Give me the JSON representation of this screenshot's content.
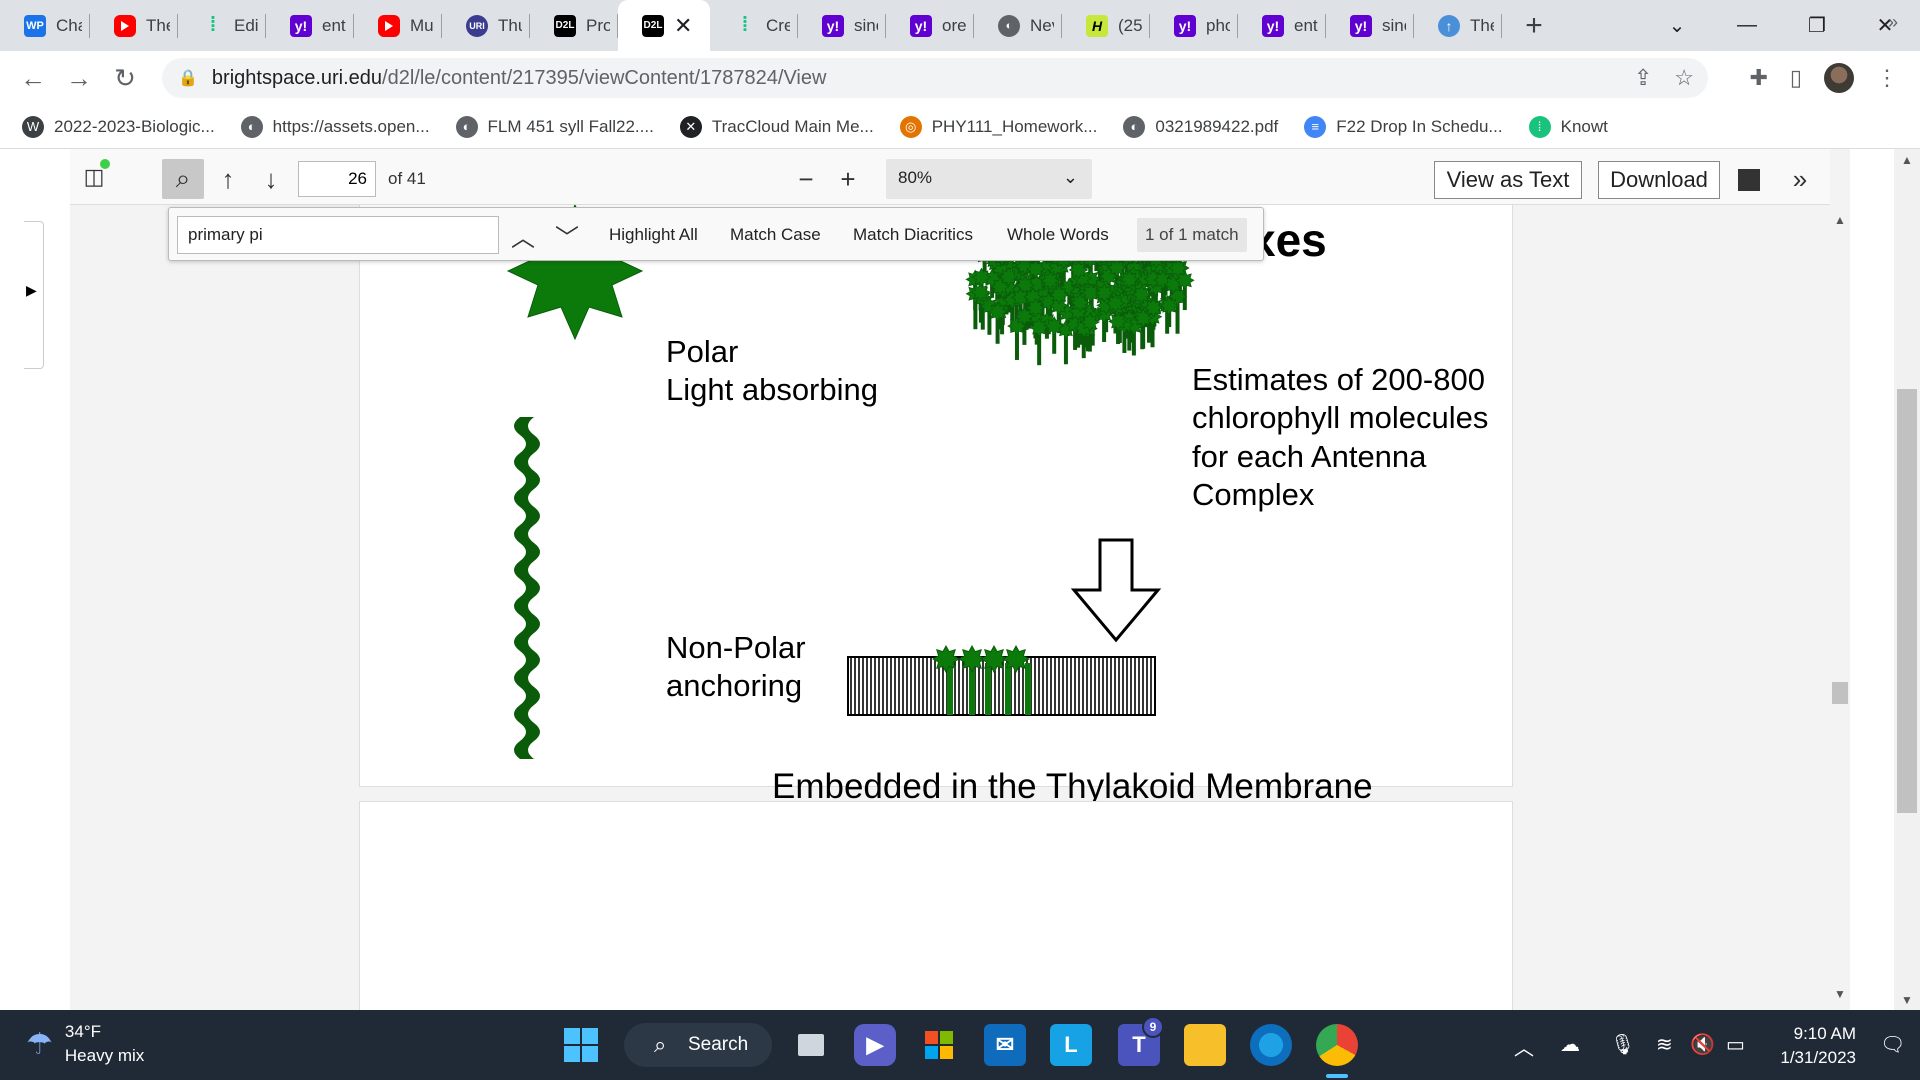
{
  "tabs": [
    {
      "label": "Cha",
      "icon": "wordpress-icon",
      "fav": "fav-wp",
      "glyph": "WP"
    },
    {
      "label": "The",
      "icon": "youtube-icon",
      "fav": "fav-yt",
      "glyph": ""
    },
    {
      "label": "Edit",
      "icon": "dots-icon",
      "fav": "fav-green",
      "glyph": "⁞"
    },
    {
      "label": "ent",
      "icon": "yahoo-icon",
      "fav": "fav-yahoo",
      "glyph": "y!"
    },
    {
      "label": "Mu",
      "icon": "youtube-icon",
      "fav": "fav-yt",
      "glyph": ""
    },
    {
      "label": "Thu",
      "icon": "uri-icon",
      "fav": "fav-uri",
      "glyph": "URI"
    },
    {
      "label": "Pro",
      "icon": "d2l-icon",
      "fav": "fav-d2l",
      "glyph": "D2L"
    },
    {
      "label": "",
      "icon": "d2l-icon",
      "fav": "fav-d2l",
      "glyph": "D2L",
      "active": true
    },
    {
      "label": "Cre",
      "icon": "dots-icon",
      "fav": "fav-green",
      "glyph": "⁞"
    },
    {
      "label": "sinc",
      "icon": "yahoo-icon",
      "fav": "fav-yahoo",
      "glyph": "y!"
    },
    {
      "label": "ore",
      "icon": "yahoo-icon",
      "fav": "fav-yahoo",
      "glyph": "y!"
    },
    {
      "label": "Nev",
      "icon": "globe-icon",
      "fav": "fav-globe",
      "glyph": "◐"
    },
    {
      "label": "(25)",
      "icon": "h-icon",
      "fav": "fav-h",
      "glyph": "H"
    },
    {
      "label": "pho",
      "icon": "yahoo-icon",
      "fav": "fav-yahoo",
      "glyph": "y!"
    },
    {
      "label": "ent",
      "icon": "yahoo-icon",
      "fav": "fav-yahoo",
      "glyph": "y!"
    },
    {
      "label": "sinc",
      "icon": "yahoo-icon",
      "fav": "fav-yahoo",
      "glyph": "y!"
    },
    {
      "label": "The",
      "icon": "upload-icon",
      "fav": "fav-up",
      "glyph": "↑"
    }
  ],
  "address": {
    "host": "brightspace.uri.edu",
    "path": "/d2l/le/content/217395/viewContent/1787824/View"
  },
  "bookmarks": [
    {
      "label": "2022-2023-Biologic...",
      "icon": "wordpress-icon",
      "color": "#3c4043",
      "glyph": "W"
    },
    {
      "label": "https://assets.open...",
      "icon": "globe-icon",
      "color": "#5f6368",
      "glyph": "◐"
    },
    {
      "label": "FLM 451 syll Fall22....",
      "icon": "globe-icon",
      "color": "#5f6368",
      "glyph": "◐"
    },
    {
      "label": "TracCloud Main Me...",
      "icon": "traccloud-icon",
      "color": "#202124",
      "glyph": "✕"
    },
    {
      "label": "PHY111_Homework...",
      "icon": "ring-icon",
      "color": "#e37400",
      "glyph": "◎"
    },
    {
      "label": "0321989422.pdf",
      "icon": "globe-icon",
      "color": "#5f6368",
      "glyph": "◐"
    },
    {
      "label": "F22 Drop In Schedu...",
      "icon": "docs-icon",
      "color": "#4285f4",
      "glyph": "≡"
    },
    {
      "label": "Knowt",
      "icon": "dots-icon",
      "color": "#19c37d",
      "glyph": "⁞"
    }
  ],
  "pdf": {
    "page_number": "26",
    "page_of": "of 41",
    "zoom": "80%",
    "view_as_text": "View as Text",
    "download": "Download"
  },
  "find": {
    "query": "primary pi",
    "highlight_all": "Highlight All",
    "match_case": "Match Case",
    "match_diacritics": "Match Diacritics",
    "whole_words": "Whole Words",
    "result": "1 of 1 match"
  },
  "slide": {
    "title_fragment": "xes",
    "polar_line1": "Polar",
    "polar_line2": "Light absorbing",
    "nonpolar_line1": "Non-Polar",
    "nonpolar_line2": "anchoring",
    "estimates_line1": "Estimates of 200-800",
    "estimates_line2": "chlorophyll molecules",
    "estimates_line3": "for each Antenna",
    "estimates_line4": "Complex",
    "caption": "Embedded in the Thylakoid Membrane"
  },
  "taskbar": {
    "temperature": "34°F",
    "weather": "Heavy mix",
    "search": "Search",
    "time": "9:10 AM",
    "date": "1/31/2023",
    "teams_badge": "9"
  },
  "colors": {
    "chlorophyll_green": "#0b7a0b",
    "chlorophyll_dark": "#0a5c0a",
    "taskbar_bg": "#202a36"
  }
}
